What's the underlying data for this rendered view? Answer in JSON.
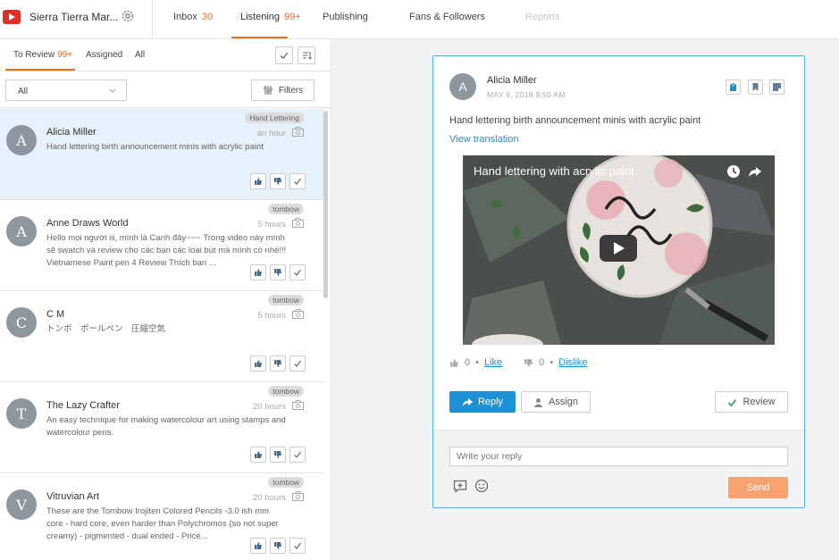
{
  "header": {
    "account_name": "Sierra Tierra Mar...",
    "tabs": [
      {
        "label": "Inbox",
        "count": "30"
      },
      {
        "label": "Listening",
        "count": "99+"
      },
      {
        "label": "Publishing",
        "count": ""
      },
      {
        "label": "Fans & Followers",
        "count": ""
      },
      {
        "label": "Reports",
        "count": ""
      }
    ]
  },
  "left_panel": {
    "subtabs": [
      {
        "label": "To Review",
        "count": "99+"
      },
      {
        "label": "Assigned",
        "count": ""
      },
      {
        "label": "All",
        "count": ""
      }
    ],
    "filter_select_value": "All",
    "filters_label": "Filters",
    "items": [
      {
        "initial": "A",
        "name": "Alicia Miller",
        "text": "Hand lettering birth announcement minis with acrylic paint",
        "badge": "Hand Lettering",
        "time": "an hour"
      },
      {
        "initial": "A",
        "name": "Anne Draws World",
        "text": "Hello mọi người iii, mình là Canh đây~~~ Trong video này mình sẽ swatch và review cho các bạn các loại bút mà mình có nhé!!! Vietnamese Paint pen 4 Review Thích bạn ...",
        "badge": "tombow",
        "time": "5 hours"
      },
      {
        "initial": "C",
        "name": "C M",
        "text": "トンボ　ボールペン　圧縮空気",
        "badge": "tombow",
        "time": "5 hours"
      },
      {
        "initial": "T",
        "name": "The Lazy Crafter",
        "text": "An easy technique for making watercolour art using stamps and watercolour pens.",
        "badge": "tombow",
        "time": "20 hours"
      },
      {
        "initial": "V",
        "name": "Vitruvian Art",
        "text": "These are the Tombow Irojiten Colored Pencils -3.0 ish mm core - hard core, even harder than Polychromos (so not super creamy) - pigmented - dual ended - Price...",
        "badge": "tombow",
        "time": "20 hours"
      }
    ]
  },
  "detail": {
    "author_initial": "A",
    "author": "Alicia Miller",
    "date": "MAY 9, 2018 9:50 AM",
    "body": "Hand lettering birth announcement minis with acrylic paint",
    "translate": "View translation",
    "video_title": "Hand lettering with acrylic paint",
    "likes": "0",
    "like_label": "Like",
    "dislikes": "0",
    "dislike_label": "Dislike",
    "reply_label": "Reply",
    "assign_label": "Assign",
    "review_label": "Review",
    "reply_placeholder": "Write your reply",
    "send_label": "Send"
  },
  "colors": {
    "accent_orange": "#f36b21",
    "link_blue": "#1e90d6",
    "selected_bg": "#e5f1fb",
    "send_btn": "#f7a26f"
  }
}
